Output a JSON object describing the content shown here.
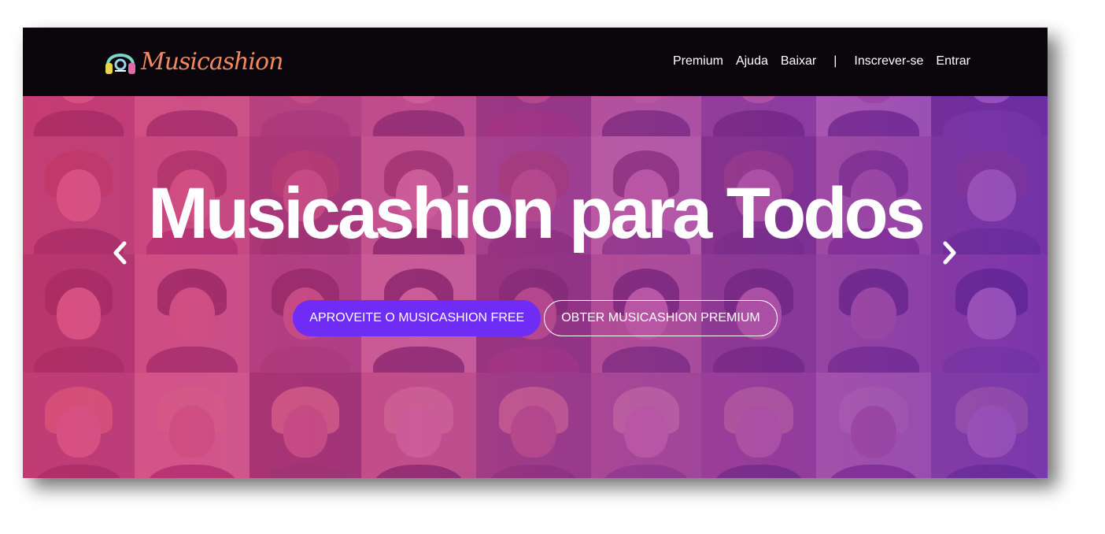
{
  "brand": {
    "name": "Musicashion"
  },
  "nav": {
    "items": [
      "Premium",
      "Ajuda",
      "Baixar"
    ],
    "separator": "|",
    "signup": "Inscrever-se",
    "login": "Entrar"
  },
  "hero": {
    "title": "Musicashion para Todos",
    "primary_button": "APROVEITE O MUSICASHION FREE",
    "secondary_button": "OBTER MUSICASHION PREMIUM"
  },
  "colors": {
    "nav_bg": "#0b060c",
    "overlay_left": "#d63478",
    "overlay_right": "#782dbe",
    "primary_button": "#6f2cf5",
    "logo_text": "#f08a5e"
  },
  "icons": {
    "prev": "chevron-left-icon",
    "next": "chevron-right-icon",
    "logo": "headphones-logo-icon"
  }
}
